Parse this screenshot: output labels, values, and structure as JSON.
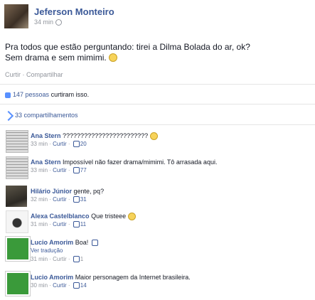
{
  "post": {
    "author": "Jeferson Monteiro",
    "time": "34 min",
    "text_line1": "Pra todos que estão perguntando: tirei a Dilma Bolada do ar, ok?",
    "text_line2": "Sem drama e sem mimimi.",
    "action_like": "Curtir",
    "action_sep": "·",
    "action_share": "Compartilhar",
    "likes_count": "147 pessoas",
    "likes_suffix": "curtiram isso.",
    "shares": "33 compartilhamentos"
  },
  "comments": [
    {
      "name": "Ana Stern",
      "text": "????????????????????????",
      "time": "33 min",
      "action": "Curtir",
      "likes": "20",
      "avatar": "newspaper"
    },
    {
      "name": "Ana Stern",
      "text": "Impossível não fazer drama/mimimi. Tô arrasada aqui.",
      "time": "33 min",
      "action": "Curtir",
      "likes": "77",
      "avatar": "newspaper"
    },
    {
      "name": "Hilário Júnior",
      "text": "gente, pq?",
      "time": "32 min",
      "action": "Curtir",
      "likes": "31",
      "avatar": "portrait"
    },
    {
      "name": "Alexa Castelblanco",
      "text": "Que tristeee",
      "time": "31 min",
      "action": "Curtir",
      "likes": "11",
      "avatar": "sketch"
    },
    {
      "name": "Lucio Amorim",
      "text": "Boa!",
      "translate": "Ver tradução",
      "time": "31 min",
      "action": "Curtir",
      "likes": "1",
      "avatar": "green"
    },
    {
      "name": "Lucio Amorim",
      "text": "Maior personagem da Internet brasileira.",
      "time": "30 min",
      "action": "Curtir",
      "likes": "14",
      "avatar": "green"
    }
  ],
  "colors": {
    "link": "#3b5998",
    "muted": "#90949c",
    "green_avatar": "#3a9a3a"
  },
  "icons": [
    "globe-icon",
    "smile-emoji-icon",
    "like-thumb-icon",
    "share-icon"
  ]
}
